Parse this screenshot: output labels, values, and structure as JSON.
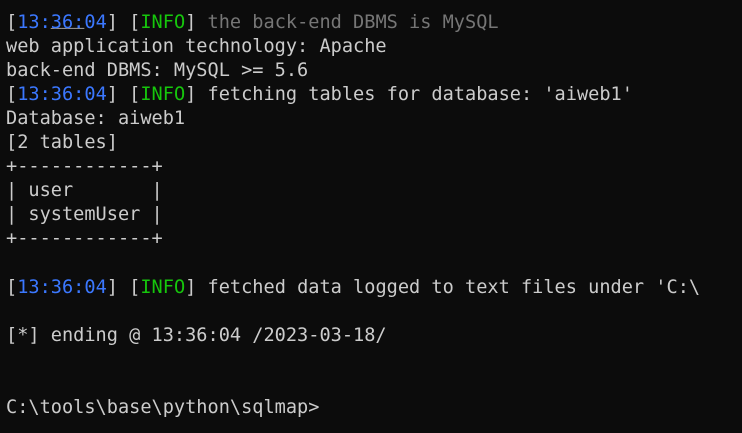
{
  "terminal": {
    "top_partial": "___",
    "lines": [
      {
        "open": "[",
        "time": "13:36:04",
        "close": "] [",
        "level": "INFO",
        "close2": "] ",
        "text": "the back-end DBMS is MySQL"
      },
      {
        "text": "web application technology: Apache"
      },
      {
        "text": "back-end DBMS: MySQL >= 5.6"
      },
      {
        "open": "[",
        "time": "13:36:04",
        "close": "] [",
        "level": "INFO",
        "close2": "] ",
        "text": "fetching tables for database: 'aiweb1'"
      },
      {
        "text": "Database: aiweb1"
      },
      {
        "text": "[2 tables]"
      },
      {
        "text": "+------------+"
      },
      {
        "text": "| user       |"
      },
      {
        "text": "| systemUser |"
      },
      {
        "text": "+------------+"
      },
      {
        "open": "[",
        "time": "13:36:04",
        "close": "] [",
        "level": "INFO",
        "close2": "] ",
        "text": "fetched data logged to text files under 'C:\\"
      },
      {
        "text": "[*] ending @ 13:36:04 /2023-03-18/"
      },
      {
        "text": "C:\\tools\\base\\python\\sqlmap>"
      }
    ]
  },
  "colors": {
    "background": "#0c0c0c",
    "foreground": "#cccccc",
    "timestamp": "#3b78ff",
    "info_level": "#16c60c",
    "dim_message": "#767676"
  }
}
